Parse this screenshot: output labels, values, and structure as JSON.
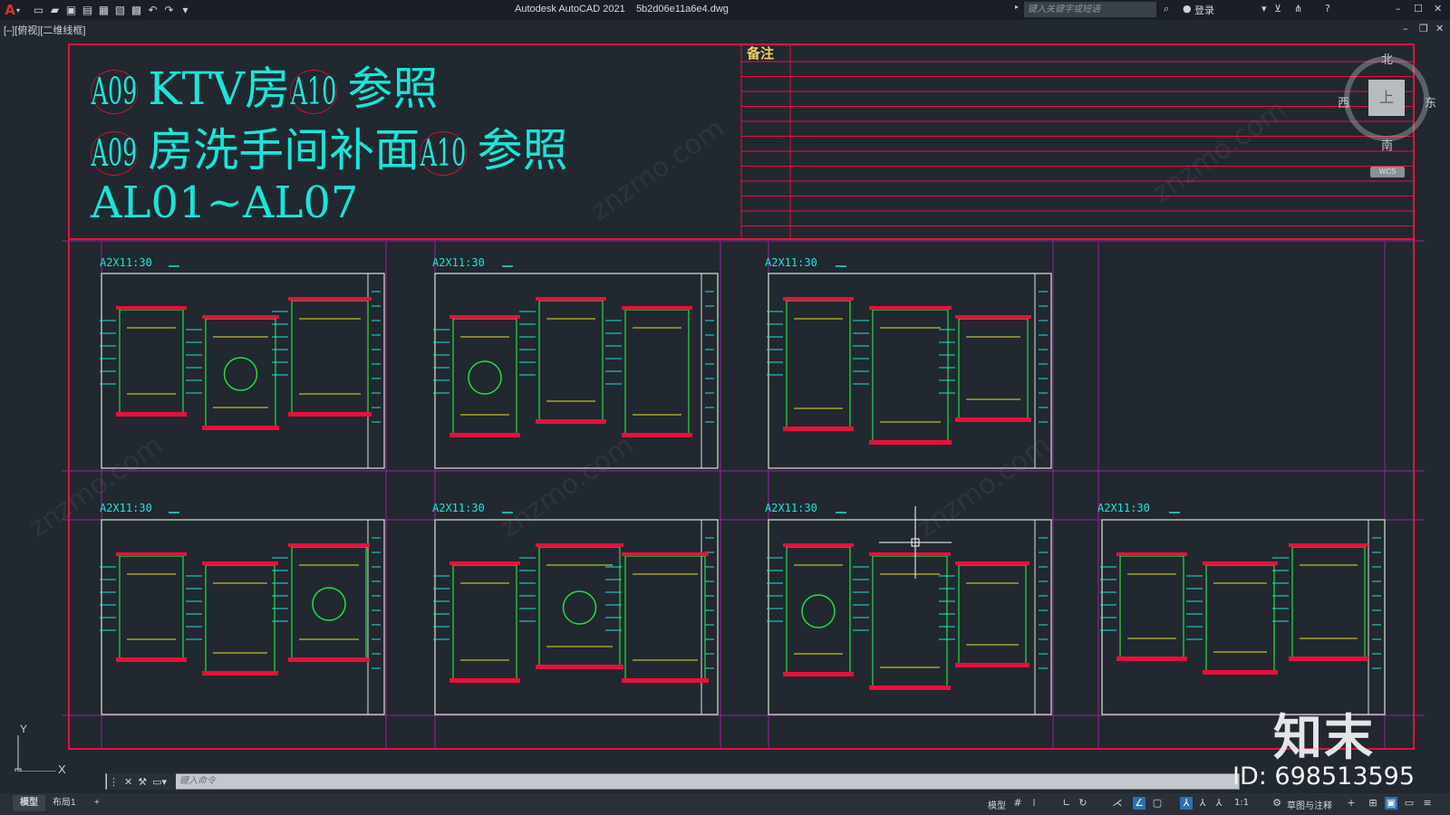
{
  "titlebar": {
    "app_title": "Autodesk AutoCAD 2021",
    "file_name": "5b2d06e11a6e4.dwg",
    "search_placeholder": "键入关键字或短语",
    "login_label": "登录",
    "window_controls": [
      "–",
      "☐",
      "✕"
    ]
  },
  "quick_access_icons": [
    "new-icon",
    "open-icon",
    "save-icon",
    "save-as-icon",
    "plot-preview-icon",
    "publish-icon",
    "print-icon",
    "undo-icon",
    "redo-icon"
  ],
  "viewport": {
    "label": "[–][俯视][二维线框]"
  },
  "drawing": {
    "line1": {
      "c1": "A09",
      "t1": "KTV房",
      "c2": "A10",
      "t2": "参照"
    },
    "line2": {
      "c1": "A09",
      "t1": "房洗手间补面",
      "c2": "A10",
      "t2": "参照"
    },
    "line3": "AL01~AL07",
    "notes_title": "备注",
    "sheet_labels": [
      "A2X11:30",
      "A2X11:30",
      "A2X11:30",
      "A2X11:30",
      "A2X11:30",
      "A2X11:30",
      "A2X11:30"
    ]
  },
  "viewcube": {
    "north": "北",
    "south": "南",
    "west": "西",
    "east": "东",
    "face": "上",
    "wcs": "WCS"
  },
  "ucs": {
    "y": "Y",
    "x": "X"
  },
  "command": {
    "placeholder": "键入命令"
  },
  "status": {
    "tabs": [
      "模型",
      "布局1"
    ],
    "add_tab": "+",
    "model_label": "模型",
    "scale": "1:1",
    "workspace": "草图与注释"
  },
  "watermark": {
    "logo": "知末",
    "id": "ID: 698513595",
    "site": "znzmo.com"
  },
  "colors": {
    "frame": "#e8103c",
    "grid": "#a0209c",
    "cyan_text": "#19e6d8",
    "green": "#22e040"
  }
}
